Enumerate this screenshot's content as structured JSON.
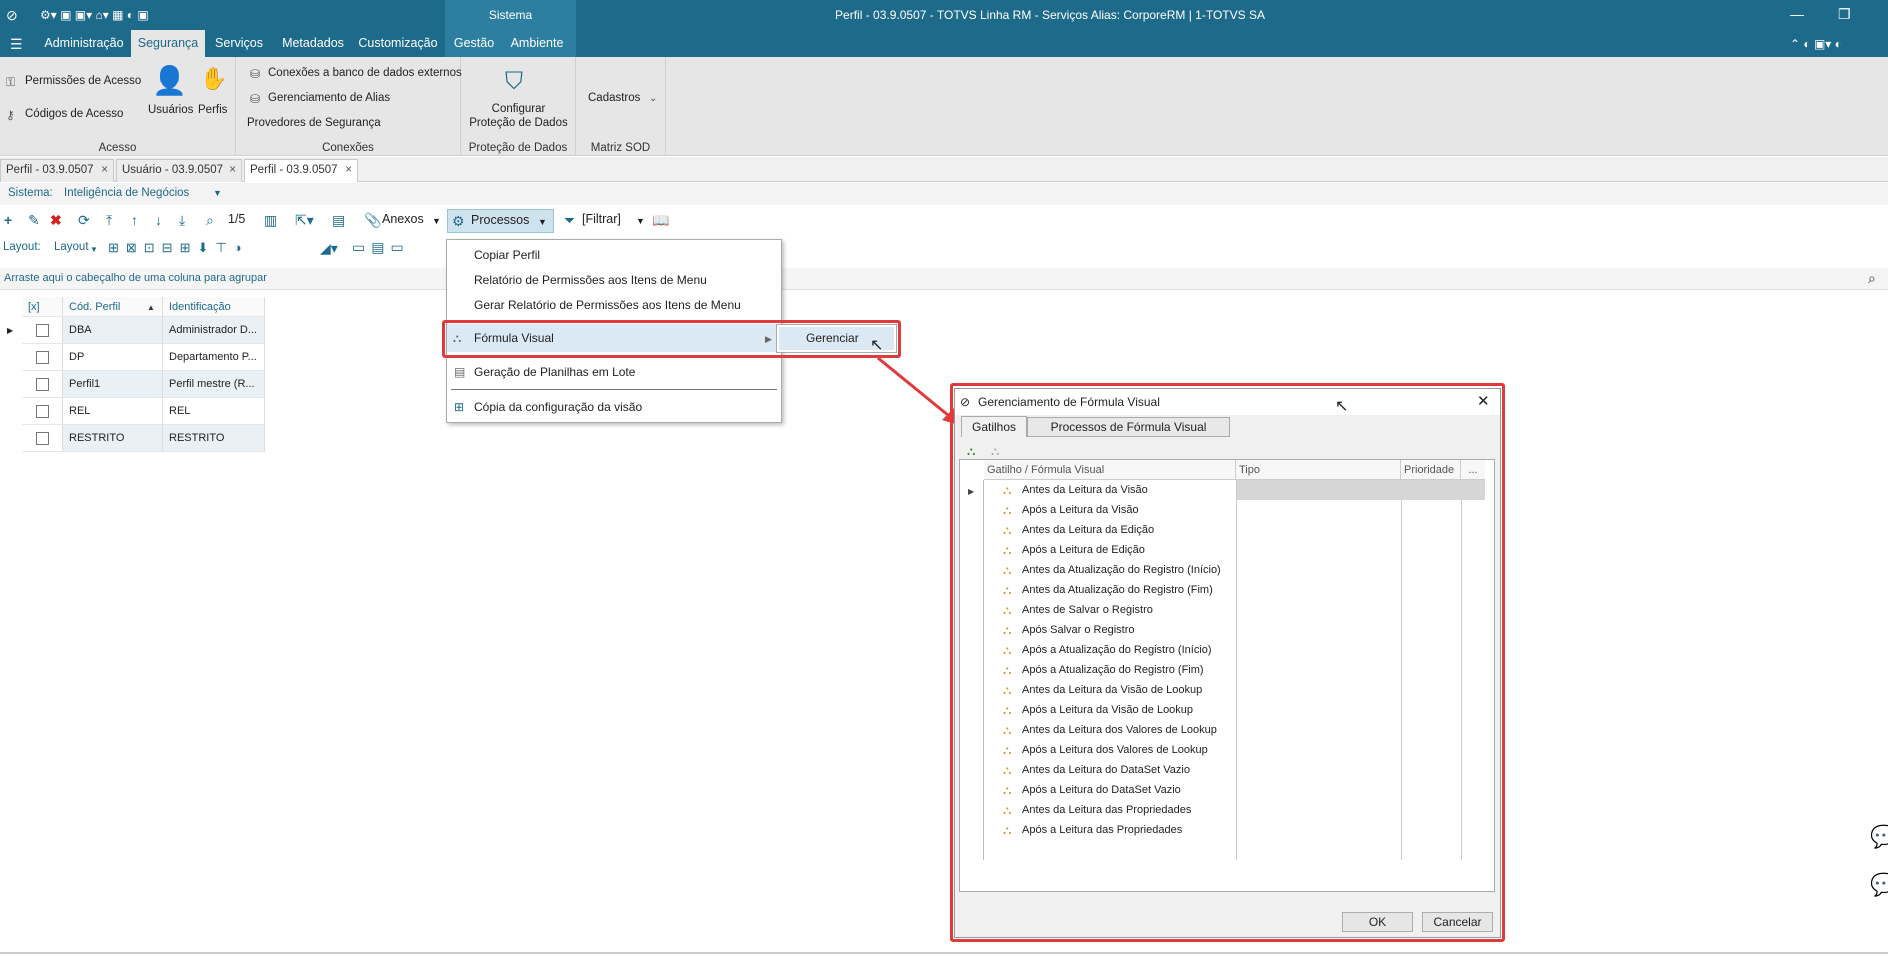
{
  "window": {
    "title": "Perfil - 03.9.0507 - TOTVS Linha RM - Serviços  Alias: CorporeRM | 1-TOTVS SA",
    "system_label": "Sistema"
  },
  "menu": {
    "tabs": [
      "Administração",
      "Segurança",
      "Serviços",
      "Metadados",
      "Customização",
      "Gestão",
      "Ambiente"
    ],
    "active": "Segurança"
  },
  "ribbon": {
    "acesso": {
      "group_label": "Acesso",
      "permissoes": "Permissões de Acesso",
      "codigos": "Códigos de Acesso",
      "usuarios": "Usuários",
      "perfis": "Perfis"
    },
    "conexoes": {
      "group_label": "Conexões",
      "banco": "Conexões a banco de dados externos",
      "alias": "Gerenciamento de Alias",
      "provedores": "Provedores de Segurança"
    },
    "protecao": {
      "group_label": "Proteção de Dados",
      "line1": "Configurar",
      "line2": "Proteção de Dados"
    },
    "matriz": {
      "group_label": "Matriz SOD",
      "cadastros": "Cadastros"
    }
  },
  "doc_tabs": [
    {
      "label": "Perfil - 03.9.0507"
    },
    {
      "label": "Usuário - 03.9.0507"
    },
    {
      "label": "Perfil - 03.9.0507"
    }
  ],
  "sistema": {
    "label": "Sistema:",
    "value": "Inteligência de Negócios"
  },
  "toolbar": {
    "record_counter": "1/5",
    "anexos": "Anexos",
    "processos": "Processos",
    "filtrar": "[Filtrar]",
    "layout_label": "Layout:",
    "layout_menu": "Layout"
  },
  "group_hint": "Arraste aqui o cabeçalho de uma coluna para agrupar",
  "grid": {
    "headers": {
      "check": "[x]",
      "cod": "Cód. Perfil",
      "ident": "Identificação"
    },
    "rows": [
      {
        "cod": "DBA",
        "ident": "Administrador D..."
      },
      {
        "cod": "DP",
        "ident": "Departamento P..."
      },
      {
        "cod": "Perfil1",
        "ident": "Perfil mestre (R..."
      },
      {
        "cod": "REL",
        "ident": "REL"
      },
      {
        "cod": "RESTRITO",
        "ident": "RESTRITO"
      }
    ]
  },
  "processos_menu": {
    "items": [
      "Copiar Perfil",
      "Relatório de Permissões aos Itens de Menu",
      "Gerar Relatório de Permissões aos Itens de Menu",
      "Fórmula Visual",
      "Geração de Planilhas em Lote",
      "Cópia da configuração da visão"
    ],
    "submenu": "Gerenciar"
  },
  "dialog": {
    "title": "Gerenciamento de Fórmula Visual",
    "tabs": [
      "Gatilhos",
      "Processos de Fórmula Visual"
    ],
    "columns": [
      "Gatilho / Fórmula Visual",
      "Tipo",
      "Prioridade",
      "..."
    ],
    "triggers": [
      "Antes da Leitura da Visão",
      "Após a Leitura da Visão",
      "Antes da Leitura da Edição",
      "Após a Leitura de Edição",
      "Antes da Atualização do Registro (Início)",
      "Antes da Atualização do Registro (Fim)",
      "Antes de Salvar o Registro",
      "Após Salvar o Registro",
      "Após a Atualização do Registro (Início)",
      "Após a Atualização do Registro (Fim)",
      "Antes da Leitura da Visão de Lookup",
      "Após a Leitura da Visão de Lookup",
      "Antes da Leitura dos Valores de Lookup",
      "Após a Leitura dos Valores de Lookup",
      "Antes da Leitura do DataSet Vazio",
      "Após a Leitura do DataSet Vazio",
      "Antes da Leitura das Propriedades",
      "Após a Leitura das Propriedades"
    ],
    "ok": "OK",
    "cancel": "Cancelar"
  },
  "colors": {
    "brand": "#1e6a8a",
    "highlight": "#e03a3a"
  }
}
